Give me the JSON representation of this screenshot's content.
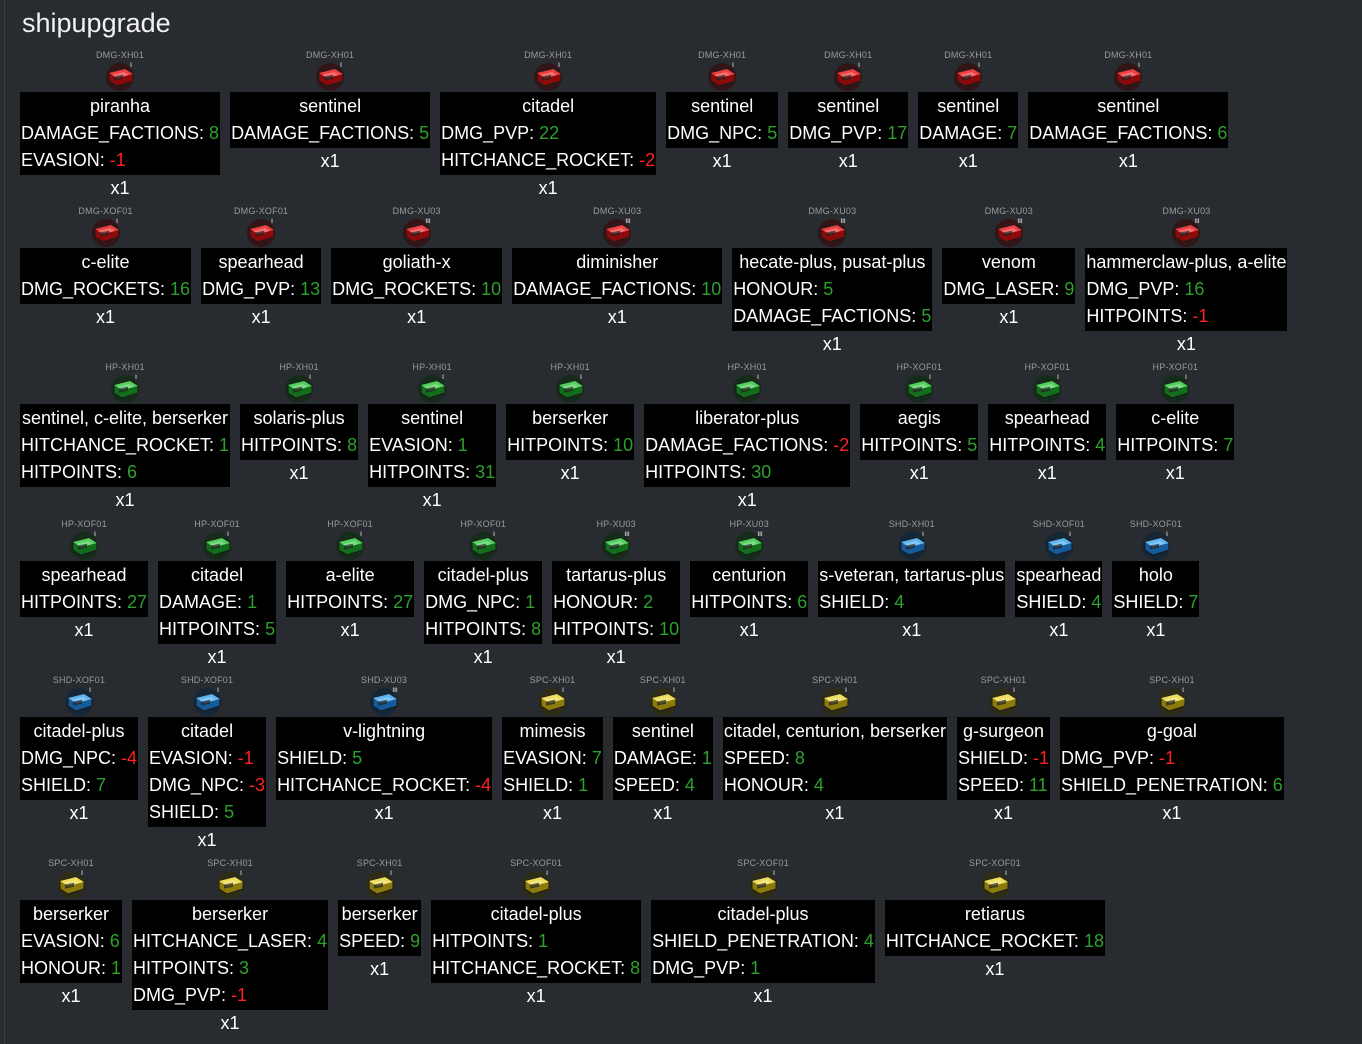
{
  "page": {
    "title": "shipupgrade"
  },
  "colors": {
    "background": "#282b30",
    "positive": "#2ea02e",
    "negative": "#ff2020",
    "box": "#000000"
  },
  "rows": [
    {
      "items": [
        {
          "code": "DMG-XH01",
          "icon": "red-upgrade-chip-icon",
          "tier": "I",
          "name": "piranha",
          "stats": [
            {
              "key": "DAMAGE_FACTIONS: ",
              "value": "8"
            },
            {
              "key": "EVASION: ",
              "value": "-1"
            }
          ],
          "qty": "x1"
        },
        {
          "code": "DMG-XH01",
          "icon": "red-upgrade-chip-icon",
          "tier": "I",
          "name": "sentinel",
          "stats": [
            {
              "key": "DAMAGE_FACTIONS: ",
              "value": "5"
            }
          ],
          "qty": "x1"
        },
        {
          "code": "DMG-XH01",
          "icon": "red-upgrade-chip-icon",
          "tier": "I",
          "name": "citadel",
          "stats": [
            {
              "key": "DMG_PVP: ",
              "value": "22"
            },
            {
              "key": "HITCHANCE_ROCKET: ",
              "value": "-2"
            }
          ],
          "qty": "x1"
        },
        {
          "code": "DMG-XH01",
          "icon": "red-upgrade-chip-icon",
          "tier": "I",
          "name": "sentinel",
          "stats": [
            {
              "key": "DMG_NPC: ",
              "value": "5"
            }
          ],
          "qty": "x1"
        },
        {
          "code": "DMG-XH01",
          "icon": "red-upgrade-chip-icon",
          "tier": "I",
          "name": "sentinel",
          "stats": [
            {
              "key": "DMG_PVP: ",
              "value": "17"
            }
          ],
          "qty": "x1"
        },
        {
          "code": "DMG-XH01",
          "icon": "red-upgrade-chip-icon",
          "tier": "I",
          "name": "sentinel",
          "stats": [
            {
              "key": "DAMAGE: ",
              "value": "7"
            }
          ],
          "qty": "x1"
        },
        {
          "code": "DMG-XH01",
          "icon": "red-upgrade-chip-icon",
          "tier": "I",
          "name": "sentinel",
          "stats": [
            {
              "key": "DAMAGE_FACTIONS: ",
              "value": "6"
            }
          ],
          "qty": "x1"
        }
      ]
    },
    {
      "items": [
        {
          "code": "DMG-XOF01",
          "icon": "red-upgrade-chip-icon",
          "tier": "I",
          "name": "c-elite",
          "stats": [
            {
              "key": "DMG_ROCKETS: ",
              "value": "16"
            }
          ],
          "qty": "x1"
        },
        {
          "code": "DMG-XOF01",
          "icon": "red-upgrade-chip-icon",
          "tier": "I",
          "name": "spearhead",
          "stats": [
            {
              "key": "DMG_PVP: ",
              "value": "13"
            }
          ],
          "qty": "x1"
        },
        {
          "code": "DMG-XU03",
          "icon": "red-upgrade-chip-icon",
          "tier": "III",
          "name": "goliath-x",
          "stats": [
            {
              "key": "DMG_ROCKETS: ",
              "value": "10"
            }
          ],
          "qty": "x1"
        },
        {
          "code": "DMG-XU03",
          "icon": "red-upgrade-chip-icon",
          "tier": "III",
          "name": "diminisher",
          "stats": [
            {
              "key": "DAMAGE_FACTIONS: ",
              "value": "10"
            }
          ],
          "qty": "x1"
        },
        {
          "code": "DMG-XU03",
          "icon": "red-upgrade-chip-icon",
          "tier": "III",
          "name": "hecate-plus, pusat-plus",
          "stats": [
            {
              "key": "HONOUR: ",
              "value": "5"
            },
            {
              "key": "DAMAGE_FACTIONS: ",
              "value": "5"
            }
          ],
          "qty": "x1"
        },
        {
          "code": "DMG-XU03",
          "icon": "red-upgrade-chip-icon",
          "tier": "III",
          "name": "venom",
          "stats": [
            {
              "key": "DMG_LASER: ",
              "value": "9"
            }
          ],
          "qty": "x1"
        },
        {
          "code": "DMG-XU03",
          "icon": "red-upgrade-chip-icon",
          "tier": "III",
          "name": "hammerclaw-plus, a-elite",
          "stats": [
            {
              "key": "DMG_PVP: ",
              "value": "16"
            },
            {
              "key": "HITPOINTS: ",
              "value": "-1"
            }
          ],
          "qty": "x1"
        }
      ]
    },
    {
      "items": [
        {
          "code": "HP-XH01",
          "icon": "green-upgrade-chip-icon",
          "tier": "I",
          "name": "sentinel, c-elite, berserker",
          "stats": [
            {
              "key": "HITCHANCE_ROCKET: ",
              "value": "1"
            },
            {
              "key": "HITPOINTS: ",
              "value": "6"
            }
          ],
          "qty": "x1"
        },
        {
          "code": "HP-XH01",
          "icon": "green-upgrade-chip-icon",
          "tier": "I",
          "name": "solaris-plus",
          "stats": [
            {
              "key": "HITPOINTS: ",
              "value": "8"
            }
          ],
          "qty": "x1"
        },
        {
          "code": "HP-XH01",
          "icon": "green-upgrade-chip-icon",
          "tier": "I",
          "name": "sentinel",
          "stats": [
            {
              "key": "EVASION: ",
              "value": "1"
            },
            {
              "key": "HITPOINTS: ",
              "value": "31"
            }
          ],
          "qty": "x1"
        },
        {
          "code": "HP-XH01",
          "icon": "green-upgrade-chip-icon",
          "tier": "I",
          "name": "berserker",
          "stats": [
            {
              "key": "HITPOINTS: ",
              "value": "10"
            }
          ],
          "qty": "x1"
        },
        {
          "code": "HP-XH01",
          "icon": "green-upgrade-chip-icon",
          "tier": "I",
          "name": "liberator-plus",
          "stats": [
            {
              "key": "DAMAGE_FACTIONS: ",
              "value": "-2"
            },
            {
              "key": "HITPOINTS: ",
              "value": "30"
            }
          ],
          "qty": "x1"
        },
        {
          "code": "HP-XOF01",
          "icon": "green-upgrade-chip-icon",
          "tier": "I",
          "name": "aegis",
          "stats": [
            {
              "key": "HITPOINTS: ",
              "value": "5"
            }
          ],
          "qty": "x1"
        },
        {
          "code": "HP-XOF01",
          "icon": "green-upgrade-chip-icon",
          "tier": "I",
          "name": "spearhead",
          "stats": [
            {
              "key": "HITPOINTS: ",
              "value": "4"
            }
          ],
          "qty": "x1"
        },
        {
          "code": "HP-XOF01",
          "icon": "green-upgrade-chip-icon",
          "tier": "I",
          "name": "c-elite",
          "stats": [
            {
              "key": "HITPOINTS: ",
              "value": "7"
            }
          ],
          "qty": "x1"
        }
      ]
    },
    {
      "items": [
        {
          "code": "HP-XOF01",
          "icon": "green-upgrade-chip-icon",
          "tier": "I",
          "name": "spearhead",
          "stats": [
            {
              "key": "HITPOINTS: ",
              "value": "27"
            }
          ],
          "qty": "x1"
        },
        {
          "code": "HP-XOF01",
          "icon": "green-upgrade-chip-icon",
          "tier": "I",
          "name": "citadel",
          "stats": [
            {
              "key": "DAMAGE: ",
              "value": "1"
            },
            {
              "key": "HITPOINTS: ",
              "value": "5"
            }
          ],
          "qty": "x1"
        },
        {
          "code": "HP-XOF01",
          "icon": "green-upgrade-chip-icon",
          "tier": "I",
          "name": "a-elite",
          "stats": [
            {
              "key": "HITPOINTS: ",
              "value": "27"
            }
          ],
          "qty": "x1"
        },
        {
          "code": "HP-XOF01",
          "icon": "green-upgrade-chip-icon",
          "tier": "I",
          "name": "citadel-plus",
          "stats": [
            {
              "key": "DMG_NPC: ",
              "value": "1"
            },
            {
              "key": "HITPOINTS: ",
              "value": "8"
            }
          ],
          "qty": "x1"
        },
        {
          "code": "HP-XU03",
          "icon": "green-upgrade-chip-icon",
          "tier": "III",
          "name": "tartarus-plus",
          "stats": [
            {
              "key": "HONOUR: ",
              "value": "2"
            },
            {
              "key": "HITPOINTS: ",
              "value": "10"
            }
          ],
          "qty": "x1"
        },
        {
          "code": "HP-XU03",
          "icon": "green-upgrade-chip-icon",
          "tier": "III",
          "name": "centurion",
          "stats": [
            {
              "key": "HITPOINTS: ",
              "value": "6"
            }
          ],
          "qty": "x1"
        },
        {
          "code": "SHD-XH01",
          "icon": "blue-upgrade-chip-icon",
          "tier": "I",
          "name": "s-veteran, tartarus-plus",
          "stats": [
            {
              "key": "SHIELD: ",
              "value": "4"
            }
          ],
          "qty": "x1"
        },
        {
          "code": "SHD-XOF01",
          "icon": "blue-upgrade-chip-icon",
          "tier": "I",
          "name": "spearhead",
          "stats": [
            {
              "key": "SHIELD: ",
              "value": "4"
            }
          ],
          "qty": "x1"
        },
        {
          "code": "SHD-XOF01",
          "icon": "blue-upgrade-chip-icon",
          "tier": "I",
          "name": "holo",
          "stats": [
            {
              "key": "SHIELD: ",
              "value": "7"
            }
          ],
          "qty": "x1"
        }
      ]
    },
    {
      "items": [
        {
          "code": "SHD-XOF01",
          "icon": "blue-upgrade-chip-icon",
          "tier": "I",
          "name": "citadel-plus",
          "stats": [
            {
              "key": "DMG_NPC: ",
              "value": "-4"
            },
            {
              "key": "SHIELD: ",
              "value": "7"
            }
          ],
          "qty": "x1"
        },
        {
          "code": "SHD-XOF01",
          "icon": "blue-upgrade-chip-icon",
          "tier": "I",
          "name": "citadel",
          "stats": [
            {
              "key": "EVASION: ",
              "value": "-1"
            },
            {
              "key": "DMG_NPC: ",
              "value": "-3"
            },
            {
              "key": "SHIELD: ",
              "value": "5"
            }
          ],
          "qty": "x1"
        },
        {
          "code": "SHD-XU03",
          "icon": "blue-upgrade-chip-icon",
          "tier": "III",
          "name": "v-lightning",
          "stats": [
            {
              "key": "SHIELD: ",
              "value": "5"
            },
            {
              "key": "HITCHANCE_ROCKET: ",
              "value": "-4"
            }
          ],
          "qty": "x1"
        },
        {
          "code": "SPC-XH01",
          "icon": "yellow-upgrade-chip-icon",
          "tier": "I",
          "name": "mimesis",
          "stats": [
            {
              "key": "EVASION: ",
              "value": "7"
            },
            {
              "key": "SHIELD: ",
              "value": "1"
            }
          ],
          "qty": "x1"
        },
        {
          "code": "SPC-XH01",
          "icon": "yellow-upgrade-chip-icon",
          "tier": "I",
          "name": "sentinel",
          "stats": [
            {
              "key": "DAMAGE: ",
              "value": "1"
            },
            {
              "key": "SPEED: ",
              "value": "4"
            }
          ],
          "qty": "x1"
        },
        {
          "code": "SPC-XH01",
          "icon": "yellow-upgrade-chip-icon",
          "tier": "I",
          "name": "citadel, centurion, berserker",
          "stats": [
            {
              "key": "SPEED: ",
              "value": "8"
            },
            {
              "key": "HONOUR: ",
              "value": "4"
            }
          ],
          "qty": "x1"
        },
        {
          "code": "SPC-XH01",
          "icon": "yellow-upgrade-chip-icon",
          "tier": "I",
          "name": "g-surgeon",
          "stats": [
            {
              "key": "SHIELD: ",
              "value": "-1"
            },
            {
              "key": "SPEED: ",
              "value": "11"
            }
          ],
          "qty": "x1"
        },
        {
          "code": "SPC-XH01",
          "icon": "yellow-upgrade-chip-icon",
          "tier": "I",
          "name": "g-goal",
          "stats": [
            {
              "key": "DMG_PVP: ",
              "value": "-1"
            },
            {
              "key": "SHIELD_PENETRATION: ",
              "value": "6"
            }
          ],
          "qty": "x1"
        }
      ]
    },
    {
      "items": [
        {
          "code": "SPC-XH01",
          "icon": "yellow-upgrade-chip-icon",
          "tier": "I",
          "name": "berserker",
          "stats": [
            {
              "key": "EVASION: ",
              "value": "6"
            },
            {
              "key": "HONOUR: ",
              "value": "1"
            }
          ],
          "qty": "x1"
        },
        {
          "code": "SPC-XH01",
          "icon": "yellow-upgrade-chip-icon",
          "tier": "I",
          "name": "berserker",
          "stats": [
            {
              "key": "HITCHANCE_LASER: ",
              "value": "4"
            },
            {
              "key": "HITPOINTS: ",
              "value": "3"
            },
            {
              "key": "DMG_PVP: ",
              "value": "-1"
            }
          ],
          "qty": "x1"
        },
        {
          "code": "SPC-XH01",
          "icon": "yellow-upgrade-chip-icon",
          "tier": "I",
          "name": "berserker",
          "stats": [
            {
              "key": "SPEED: ",
              "value": "9"
            }
          ],
          "qty": "x1"
        },
        {
          "code": "SPC-XOF01",
          "icon": "yellow-upgrade-chip-icon",
          "tier": "I",
          "name": "citadel-plus",
          "stats": [
            {
              "key": "HITPOINTS: ",
              "value": "1"
            },
            {
              "key": "HITCHANCE_ROCKET: ",
              "value": "8"
            }
          ],
          "qty": "x1"
        },
        {
          "code": "SPC-XOF01",
          "icon": "yellow-upgrade-chip-icon",
          "tier": "I",
          "name": "citadel-plus",
          "stats": [
            {
              "key": "SHIELD_PENETRATION: ",
              "value": "4"
            },
            {
              "key": "DMG_PVP: ",
              "value": "1"
            }
          ],
          "qty": "x1"
        },
        {
          "code": "SPC-XOF01",
          "icon": "yellow-upgrade-chip-icon",
          "tier": "I",
          "name": "retiarus",
          "stats": [
            {
              "key": "HITCHANCE_ROCKET: ",
              "value": "18"
            }
          ],
          "qty": "x1"
        }
      ]
    }
  ]
}
